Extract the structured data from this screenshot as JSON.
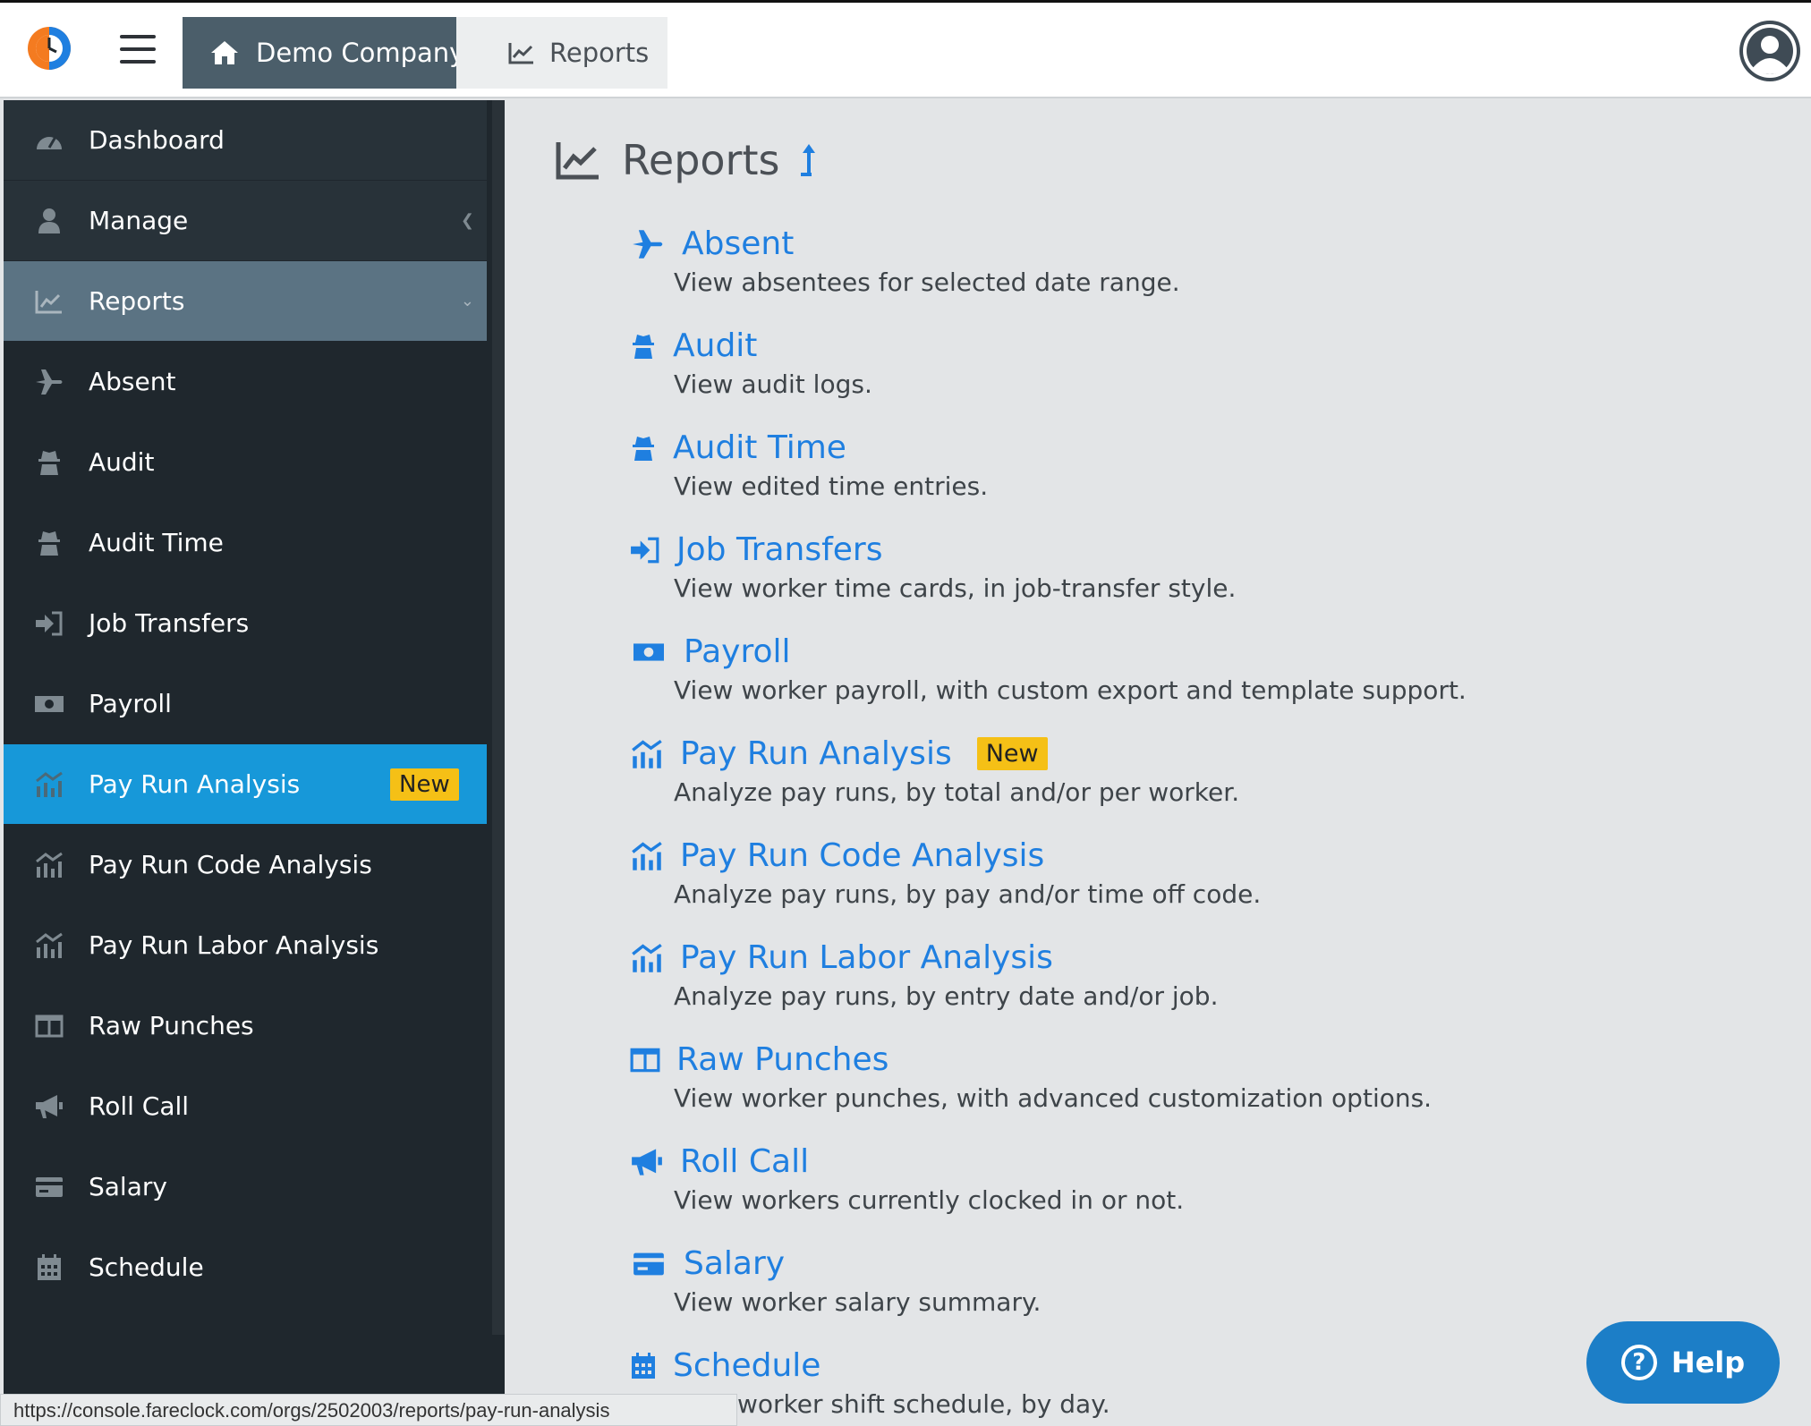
{
  "header": {
    "breadcrumb": [
      {
        "label": "Demo Company",
        "icon": "home-icon"
      },
      {
        "label": "Reports",
        "icon": "chart-line-icon"
      }
    ]
  },
  "sidebar": {
    "items": [
      {
        "label": "Dashboard",
        "icon": "dashboard-icon"
      },
      {
        "label": "Manage",
        "icon": "user-icon"
      },
      {
        "label": "Reports",
        "icon": "chart-line-icon"
      },
      {
        "label": "Absent",
        "icon": "plane-icon"
      },
      {
        "label": "Audit",
        "icon": "spy-icon"
      },
      {
        "label": "Audit Time",
        "icon": "spy-icon"
      },
      {
        "label": "Job Transfers",
        "icon": "sign-in-icon"
      },
      {
        "label": "Payroll",
        "icon": "money-icon"
      },
      {
        "label": "Pay Run Analysis",
        "icon": "chart-mixed-icon",
        "badge": "New"
      },
      {
        "label": "Pay Run Code Analysis",
        "icon": "chart-mixed-icon"
      },
      {
        "label": "Pay Run Labor Analysis",
        "icon": "chart-mixed-icon"
      },
      {
        "label": "Raw Punches",
        "icon": "columns-icon"
      },
      {
        "label": "Roll Call",
        "icon": "bullhorn-icon"
      },
      {
        "label": "Salary",
        "icon": "credit-card-icon"
      },
      {
        "label": "Schedule",
        "icon": "calendar-icon"
      }
    ]
  },
  "main": {
    "title": "Reports",
    "reports": [
      {
        "title": "Absent",
        "desc": "View absentees for selected date range.",
        "icon": "plane-icon"
      },
      {
        "title": "Audit",
        "desc": "View audit logs.",
        "icon": "spy-icon"
      },
      {
        "title": "Audit Time",
        "desc": "View edited time entries.",
        "icon": "spy-icon"
      },
      {
        "title": "Job Transfers",
        "desc": "View worker time cards, in job-transfer style.",
        "icon": "sign-in-icon"
      },
      {
        "title": "Payroll",
        "desc": "View worker payroll, with custom export and template support.",
        "icon": "money-icon"
      },
      {
        "title": "Pay Run Analysis",
        "desc": "Analyze pay runs, by total and/or per worker.",
        "icon": "chart-mixed-icon",
        "badge": "New"
      },
      {
        "title": "Pay Run Code Analysis",
        "desc": "Analyze pay runs, by pay and/or time off code.",
        "icon": "chart-mixed-icon"
      },
      {
        "title": "Pay Run Labor Analysis",
        "desc": "Analyze pay runs, by entry date and/or job.",
        "icon": "chart-mixed-icon"
      },
      {
        "title": "Raw Punches",
        "desc": "View worker punches, with advanced customization options.",
        "icon": "columns-icon"
      },
      {
        "title": "Roll Call",
        "desc": "View workers currently clocked in or not.",
        "icon": "bullhorn-icon"
      },
      {
        "title": "Salary",
        "desc": "View worker salary summary.",
        "icon": "credit-card-icon"
      },
      {
        "title": "Schedule",
        "desc": "worker shift schedule, by day.",
        "icon": "calendar-icon"
      }
    ]
  },
  "help": {
    "label": "Help"
  },
  "status_url": "https://console.fareclock.com/orgs/2502003/reports/pay-run-analysis",
  "colors": {
    "link": "#1f7fe0",
    "sidebar_bg": "#1f272d",
    "active": "#1798d9",
    "badge": "#f5c016",
    "help": "#1c7ec7"
  }
}
